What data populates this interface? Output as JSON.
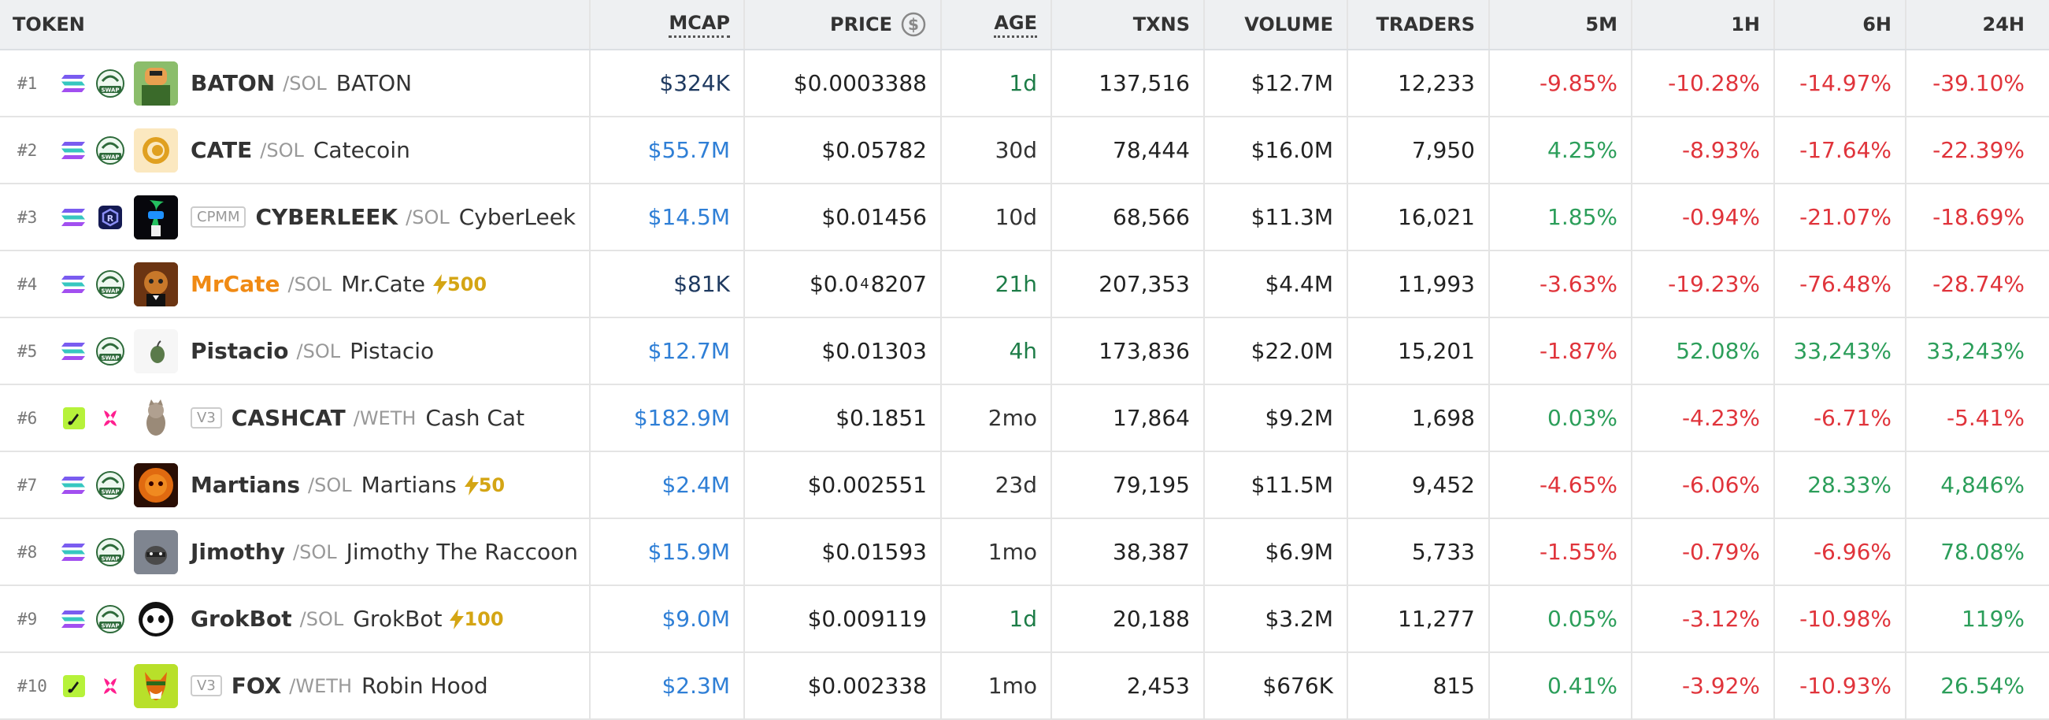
{
  "columns": {
    "token": "TOKEN",
    "mcap": "MCAP",
    "price": "PRICE",
    "age": "AGE",
    "txns": "TXNS",
    "volume": "VOLUME",
    "traders": "TRADERS",
    "m5": "5M",
    "h1": "1H",
    "h6": "6H",
    "h24": "24H"
  },
  "rows": [
    {
      "rank": "#1",
      "chain": "solana-icon",
      "dex": "swap-icon",
      "symbol": "BATON",
      "pair": "/SOL",
      "name": "BATON",
      "mcap": "$324K",
      "price": "$0.0003388",
      "age": "1d",
      "txns": "137,516",
      "volume": "$12.7M",
      "traders": "12,233",
      "m5": "-9.85%",
      "h1": "-10.28%",
      "h6": "-14.97%",
      "h24": "-39.10%"
    },
    {
      "rank": "#2",
      "chain": "solana-icon",
      "dex": "swap-icon",
      "symbol": "CATE",
      "pair": "/SOL",
      "name": "Catecoin",
      "mcap": "$55.7M",
      "price": "$0.05782",
      "age": "30d",
      "txns": "78,444",
      "volume": "$16.0M",
      "traders": "7,950",
      "m5": "4.25%",
      "h1": "-8.93%",
      "h6": "-17.64%",
      "h24": "-22.39%"
    },
    {
      "rank": "#3",
      "chain": "solana-icon",
      "dex": "raydium-icon",
      "tag": "CPMM",
      "symbol": "CYBERLEEK",
      "pair": "/SOL",
      "name": "CyberLeek",
      "mcap": "$14.5M",
      "price": "$0.01456",
      "age": "10d",
      "txns": "68,566",
      "volume": "$11.3M",
      "traders": "16,021",
      "m5": "1.85%",
      "h1": "-0.94%",
      "h6": "-21.07%",
      "h24": "-18.69%"
    },
    {
      "rank": "#4",
      "chain": "solana-icon",
      "dex": "swap-icon",
      "symbol": "MrCate",
      "pair": "/SOL",
      "name": "Mr.Cate",
      "boost": "500",
      "mcap": "$81K",
      "price_pre": "$0.0",
      "price_sub": "4",
      "price_post": "8207",
      "age": "21h",
      "txns": "207,353",
      "volume": "$4.4M",
      "traders": "11,993",
      "m5": "-3.63%",
      "h1": "-19.23%",
      "h6": "-76.48%",
      "h24": "-28.74%"
    },
    {
      "rank": "#5",
      "chain": "solana-icon",
      "dex": "swap-icon",
      "symbol": "Pistacio",
      "pair": "/SOL",
      "name": "Pistacio",
      "mcap": "$12.7M",
      "price": "$0.01303",
      "age": "4h",
      "txns": "173,836",
      "volume": "$22.0M",
      "traders": "15,201",
      "m5": "-1.87%",
      "h1": "52.08%",
      "h6": "33,243%",
      "h24": "33,243%"
    },
    {
      "rank": "#6",
      "chain": "base-icon",
      "dex": "uniswap-icon",
      "tag": "V3",
      "symbol": "CASHCAT",
      "pair": "/WETH",
      "name": "Cash Cat",
      "mcap": "$182.9M",
      "price": "$0.1851",
      "age": "2mo",
      "txns": "17,864",
      "volume": "$9.2M",
      "traders": "1,698",
      "m5": "0.03%",
      "h1": "-4.23%",
      "h6": "-6.71%",
      "h24": "-5.41%"
    },
    {
      "rank": "#7",
      "chain": "solana-icon",
      "dex": "swap-icon",
      "symbol": "Martians",
      "pair": "/SOL",
      "name": "Martians",
      "boost": "50",
      "mcap": "$2.4M",
      "price": "$0.002551",
      "age": "23d",
      "txns": "79,195",
      "volume": "$11.5M",
      "traders": "9,452",
      "m5": "-4.65%",
      "h1": "-6.06%",
      "h6": "28.33%",
      "h24": "4,846%"
    },
    {
      "rank": "#8",
      "chain": "solana-icon",
      "dex": "swap-icon",
      "symbol": "Jimothy",
      "pair": "/SOL",
      "name": "Jimothy The Raccoon",
      "mcap": "$15.9M",
      "price": "$0.01593",
      "age": "1mo",
      "txns": "38,387",
      "volume": "$6.9M",
      "traders": "5,733",
      "m5": "-1.55%",
      "h1": "-0.79%",
      "h6": "-6.96%",
      "h24": "78.08%"
    },
    {
      "rank": "#9",
      "chain": "solana-icon",
      "dex": "swap-icon",
      "symbol": "GrokBot",
      "pair": "/SOL",
      "name": "GrokBot",
      "boost": "100",
      "mcap": "$9.0M",
      "price": "$0.009119",
      "age": "1d",
      "txns": "20,188",
      "volume": "$3.2M",
      "traders": "11,277",
      "m5": "0.05%",
      "h1": "-3.12%",
      "h6": "-10.98%",
      "h24": "119%"
    },
    {
      "rank": "#10",
      "chain": "base-icon",
      "dex": "uniswap-icon",
      "tag": "V3",
      "symbol": "FOX",
      "pair": "/WETH",
      "name": "Robin Hood",
      "mcap": "$2.3M",
      "price": "$0.002338",
      "age": "1mo",
      "txns": "2,453",
      "volume": "$676K",
      "traders": "815",
      "m5": "0.41%",
      "h1": "-3.92%",
      "h6": "-10.93%",
      "h24": "26.54%"
    }
  ],
  "colors": {
    "negative": "#e0343b",
    "positive": "#2c9e5a",
    "mcap_blue": "#2f7fd6",
    "boost": "#d4a514"
  }
}
